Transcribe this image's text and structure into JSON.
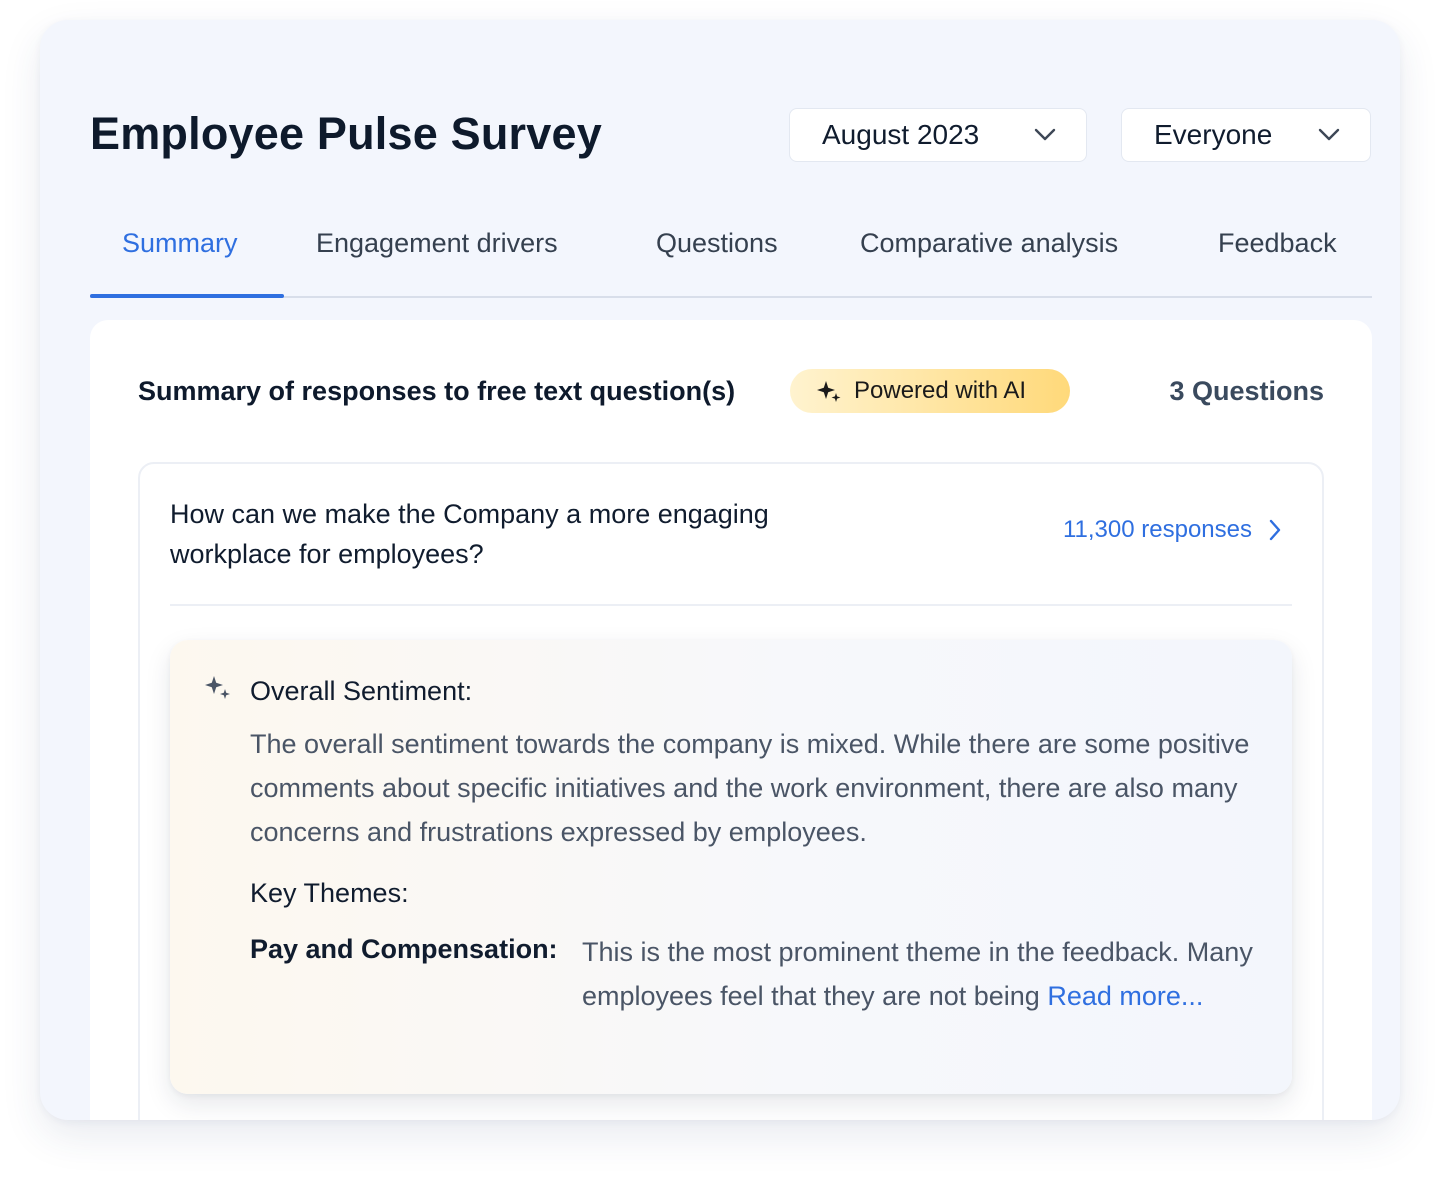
{
  "header": {
    "title": "Employee Pulse Survey",
    "date_filter": "August 2023",
    "audience_filter": "Everyone"
  },
  "tabs": [
    {
      "label": "Summary",
      "active": true
    },
    {
      "label": "Engagement drivers",
      "active": false
    },
    {
      "label": "Questions",
      "active": false
    },
    {
      "label": "Comparative analysis",
      "active": false
    },
    {
      "label": "Feedback",
      "active": false
    }
  ],
  "summary_card": {
    "title": "Summary of responses to free text question(s)",
    "ai_badge": "Powered with AI",
    "question_count": "3 Questions"
  },
  "question": {
    "text": "How can we make the Company a more engaging workplace for employees?",
    "responses_link": "11,300 responses"
  },
  "ai_summary": {
    "sentiment_title": "Overall Sentiment:",
    "sentiment_body": "The overall sentiment towards the company is mixed. While there are some positive comments about specific initiatives and the work environment, there are also many concerns and frustrations expressed by employees.",
    "themes_title": "Key Themes:",
    "theme_label": "Pay and Compensation:",
    "theme_body": "This is the most prominent theme in the feedback. Many employees feel that they are not being",
    "read_more": "Read more..."
  },
  "colors": {
    "accent": "#2f6fe0",
    "badge_gradient_start": "#fff3cf",
    "badge_gradient_end": "#ffd97a",
    "background": "#f3f6fd"
  },
  "icons": {
    "dropdown": "chevron-down-icon",
    "ai": "sparkle-icon",
    "link": "chevron-right-icon"
  }
}
